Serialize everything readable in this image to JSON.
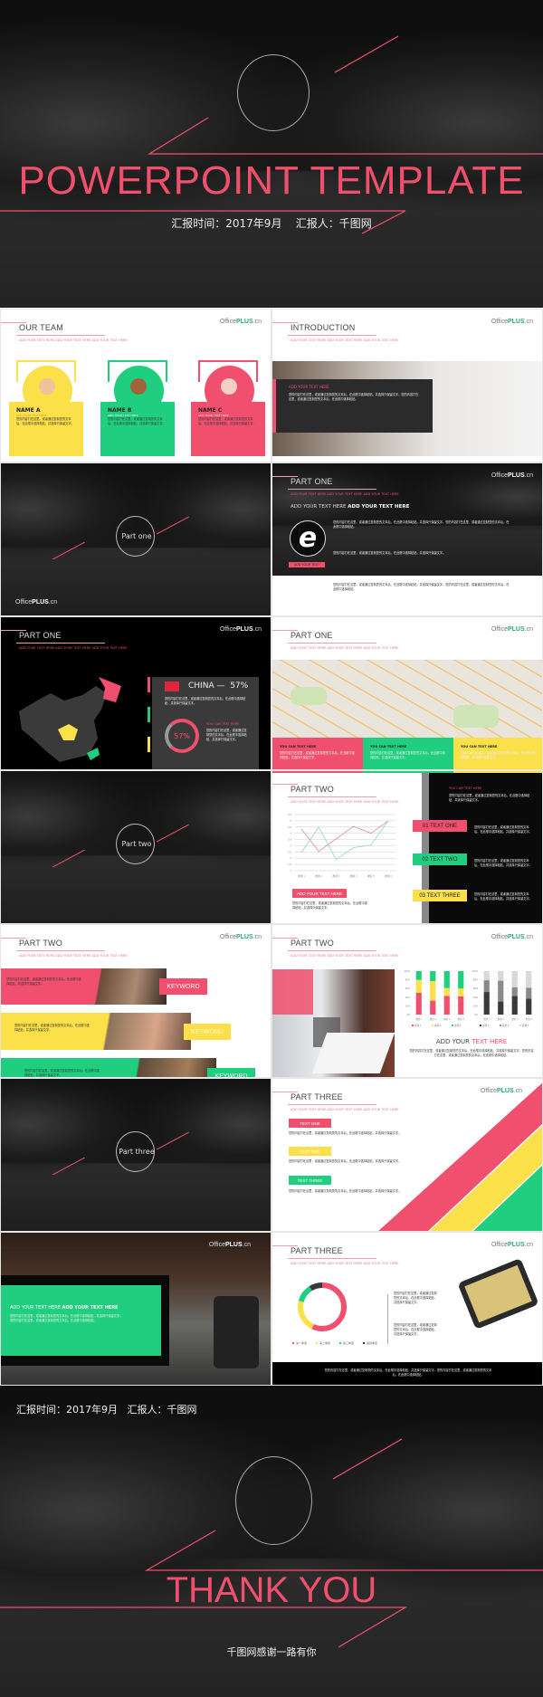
{
  "colors": {
    "red": "#f0506e",
    "green": "#1fcf7f",
    "yellow": "#fbe04a",
    "dark": "#1a1a1a"
  },
  "logo": {
    "prefix": "Office",
    "brand": "PLUS",
    "suffix": ".cn"
  },
  "subtitle": "ADD YOUR TEXT HERE ADD YOUR TEXT HERE ADD YOUR TEXT HERE",
  "body": "您的内容打在这里，或者通过复制您的文本后，在此框中选择粘贴，并选择只保留文字。您的内容打在这里，或者通过复制您的文本后，在此框中选择粘贴。",
  "body_short": "您的内容打在这里，或者通过复制您的文本后，在此框中选择粘贴，并选择只保留文字。",
  "cover": {
    "title": "POWERPOINT TEMPLATE",
    "report_time_label": "汇报时间：",
    "report_time": "2017年9月",
    "reporter_label": "汇报人：",
    "reporter": "千图网"
  },
  "team": {
    "title": "OUR TEAM",
    "members": [
      {
        "name": "NAME A",
        "sub": "ADD YOUR TEXT HERE"
      },
      {
        "name": "NAME B",
        "sub": "ADD YOUR TEXT HERE"
      },
      {
        "name": "NAME C",
        "sub": "ADD YOUR TEXT HERE"
      }
    ]
  },
  "intro": {
    "title": "INTRODUCTION",
    "heading": "ADD YOUR TEXT HERE"
  },
  "part_one_section": {
    "label": "Part one"
  },
  "part_one_a": {
    "title": "PART ONE",
    "heading_light": "ADD YOUR TEXT HERE",
    "heading_bold": "ADD YOUR TEXT HERE",
    "button": "ADD YOUR TEXT",
    "icon": "internet-explorer-icon"
  },
  "part_one_b": {
    "title": "PART ONE",
    "country": "CHINA —",
    "percent": "57%",
    "ring_label": "57%",
    "heading": "YOU CAN TEXT HERE"
  },
  "part_one_c": {
    "title": "PART ONE",
    "boxes": [
      {
        "heading": "YOU CAN TEXT HERE"
      },
      {
        "heading": "YOU CAN TEXT HERE"
      },
      {
        "heading": "YOU CAN TEXT HERE"
      }
    ]
  },
  "part_two_section": {
    "label": "Part two"
  },
  "part_two_a": {
    "title": "PART TWO",
    "button": "ADD YOUR TEXT HERE",
    "heading": "YOU CAN TEXT HERE",
    "items": [
      "01 TEXT ONE",
      "02 TEXT TWO",
      "03 TEXT THREE"
    ]
  },
  "part_two_b": {
    "title": "PART TWO",
    "keywords": [
      "KEYWORD",
      "KEYWORD",
      "KEYWORD"
    ]
  },
  "part_two_c": {
    "title": "PART TWO",
    "heading_light": "ADD YOUR ",
    "heading_accent": "TEXT HERE"
  },
  "part_three_section": {
    "label": "Part three"
  },
  "part_three_a": {
    "title": "PART THREE",
    "tags": [
      "TEXT ONE",
      "TEXT TWO",
      "TEXT THREE"
    ]
  },
  "part_three_b": {
    "heading_light": "ADD YOUR TEXT HERE",
    "heading_bold": "ADD YOUR TEXT HERE"
  },
  "part_three_c": {
    "title": "PART THREE"
  },
  "closing": {
    "report_time_label": "汇报时间：",
    "report_time": "2017年9月",
    "reporter_label": "汇报人：",
    "reporter": "千图网",
    "title": "THANK YOU",
    "tagline": "千图网感谢一路有你"
  },
  "chart_data": [
    {
      "type": "line",
      "categories": [
        "类别 1",
        "类别 2",
        "类别 3",
        "类别 4",
        "类别 5",
        "类别 6"
      ],
      "ylim": [
        1,
        5.5
      ],
      "yticks": [
        "5.5",
        "5",
        "4.5",
        "4",
        "3.5",
        "3",
        "2.5",
        "2",
        "1.5",
        "1"
      ],
      "grid": true,
      "series": [
        {
          "values": [
            4.35,
            2.55,
            3.55,
            4.55,
            4.0,
            5.0
          ],
          "color": "#e58a96"
        },
        {
          "values": [
            2.45,
            4.5,
            1.9,
            2.85,
            3.05,
            5.0
          ],
          "color": "#8ed8b4"
        }
      ]
    },
    {
      "type": "bar",
      "stacked": true,
      "categories": [
        "类别 1",
        "类别 2",
        "类别 3",
        "类别 4"
      ],
      "ylim": [
        0,
        100
      ],
      "yticks": [
        "100%",
        "80%",
        "60%",
        "40%",
        "20%",
        "0%"
      ],
      "series": [
        {
          "name": "系列 1",
          "values": [
            50,
            32,
            43,
            42
          ],
          "color": "#f0506e"
        },
        {
          "name": "系列 2",
          "values": [
            30,
            45,
            18,
            18
          ],
          "color": "#fbe04a"
        },
        {
          "name": "系列 3",
          "values": [
            20,
            23,
            39,
            40
          ],
          "color": "#1fcf7f"
        }
      ]
    },
    {
      "type": "bar",
      "stacked": true,
      "categories": [
        "类别 1",
        "类别 2",
        "类别 3",
        "类别 4"
      ],
      "ylim": [
        0,
        100
      ],
      "yticks": [
        "100%",
        "80%",
        "60%",
        "40%",
        "20%",
        "0%"
      ],
      "series": [
        {
          "name": "系列 1",
          "values": [
            52,
            30,
            43,
            37
          ],
          "color": "#3a3a3a"
        },
        {
          "name": "系列 2",
          "values": [
            27,
            48,
            20,
            25
          ],
          "color": "#8a8a8a"
        },
        {
          "name": "系列 3",
          "values": [
            21,
            22,
            37,
            38
          ],
          "color": "#d8d8d8"
        }
      ]
    },
    {
      "type": "pie",
      "donut": true,
      "categories": [
        "第一季度",
        "第二季度",
        "第三季度",
        "第四季度"
      ],
      "values": [
        57,
        22,
        12,
        9
      ],
      "colors": [
        "#f0506e",
        "#fbe04a",
        "#1fcf7f",
        "#3a3a3a"
      ]
    }
  ]
}
